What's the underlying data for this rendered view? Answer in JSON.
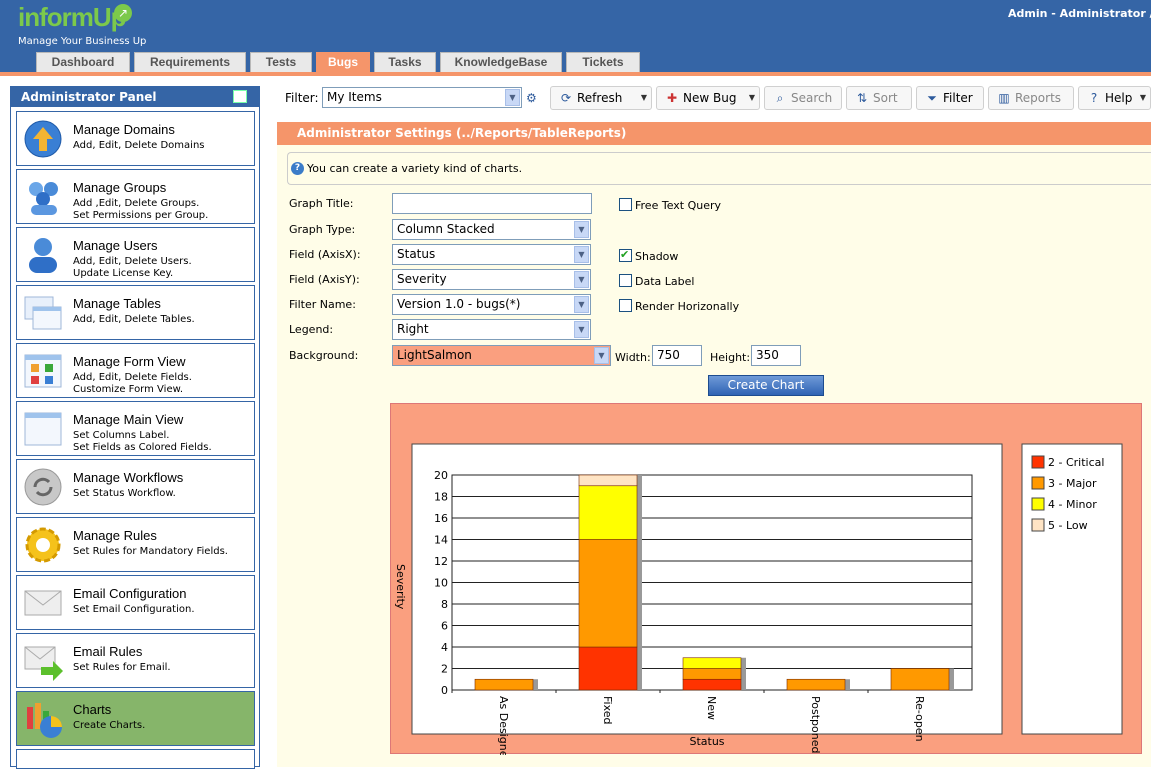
{
  "header": {
    "logo": "informUp",
    "tagline": "Manage Your Business Up",
    "user_text": "Admin -  Administrator  / S",
    "tabs": [
      {
        "label": "Dashboard"
      },
      {
        "label": "Requirements"
      },
      {
        "label": "Tests"
      },
      {
        "label": "Bugs",
        "active": true
      },
      {
        "label": "Tasks"
      },
      {
        "label": "KnowledgeBase"
      },
      {
        "label": "Tickets"
      }
    ]
  },
  "panel": {
    "title": "Administrator Panel",
    "items": [
      {
        "title": "Manage Domains",
        "desc": "Add, Edit, Delete Domains",
        "icon": "globe-icon"
      },
      {
        "title": "Manage Groups",
        "desc": "Add ,Edit, Delete Groups.\nSet Permissions per Group.",
        "icon": "group-icon"
      },
      {
        "title": "Manage Users",
        "desc": "Add, Edit, Delete Users.\nUpdate License Key.",
        "icon": "user-icon"
      },
      {
        "title": "Manage Tables",
        "desc": "Add, Edit, Delete Tables.",
        "icon": "tables-icon"
      },
      {
        "title": "Manage Form View",
        "desc": "Add, Edit, Delete Fields.\nCustomize Form View.",
        "icon": "form-view-icon"
      },
      {
        "title": "Manage Main View",
        "desc": "Set Columns Label.\nSet Fields as Colored Fields.",
        "icon": "main-view-icon"
      },
      {
        "title": "Manage Workflows",
        "desc": "Set Status Workflow.",
        "icon": "workflow-icon"
      },
      {
        "title": "Manage Rules",
        "desc": "Set Rules for Mandatory Fields.",
        "icon": "gear-icon"
      },
      {
        "title": "Email Configuration",
        "desc": "Set Email Configuration.",
        "icon": "envelope-icon"
      },
      {
        "title": "Email Rules",
        "desc": "Set Rules for Email.",
        "icon": "email-rules-icon"
      },
      {
        "title": "Charts",
        "desc": "Create Charts.",
        "icon": "chart-icon",
        "active": true
      }
    ]
  },
  "toolbar": {
    "filter_label": "Filter:",
    "filter_value": "My Items",
    "refresh": "Refresh",
    "new_bug": "New Bug",
    "search": "Search",
    "sort": "Sort",
    "filter": "Filter",
    "reports": "Reports",
    "help": "Help"
  },
  "settings": {
    "bar_title": "Administrator Settings  (../Reports/TableReports)",
    "info": "You can create a variety kind of charts.",
    "graph_title_label": "Graph Title:",
    "graph_title_value": "",
    "graph_type_label": "Graph Type:",
    "graph_type_value": "Column Stacked",
    "axis_x_label": "Field (AxisX):",
    "axis_x_value": "Status",
    "axis_y_label": "Field (AxisY):",
    "axis_y_value": "Severity",
    "filter_name_label": "Filter Name:",
    "filter_name_value": "Version 1.0 - bugs(*)",
    "legend_label": "Legend:",
    "legend_value": "Right",
    "background_label": "Background:",
    "background_value": "LightSalmon",
    "width_label": "Width:",
    "width_value": "750",
    "height_label": "Height:",
    "height_value": "350",
    "free_text_query": "Free Text Query",
    "shadow": "Shadow",
    "data_label": "Data Label",
    "render_horizontally": "Render Horizonally",
    "free_text_checked": false,
    "shadow_checked": true,
    "data_label_checked": false,
    "render_horizontally_checked": false,
    "create_button": "Create Chart"
  },
  "chart_data": {
    "type": "bar",
    "stacked": true,
    "categories": [
      "As Designed",
      "Fixed",
      "New",
      "Postponed",
      "Re-open"
    ],
    "series": [
      {
        "name": "2 - Critical",
        "color": "#ff3300",
        "values": [
          0,
          4,
          1,
          0,
          0
        ]
      },
      {
        "name": "3 - Major",
        "color": "#ff9900",
        "values": [
          1,
          10,
          1,
          1,
          2
        ]
      },
      {
        "name": "4 - Minor",
        "color": "#ffff00",
        "values": [
          0,
          5,
          1,
          0,
          0
        ]
      },
      {
        "name": "5 - Low",
        "color": "#ffe4c4",
        "values": [
          0,
          1,
          0,
          0,
          0
        ]
      }
    ],
    "title": "",
    "xlabel": "Status",
    "ylabel": "Severity",
    "ylim": [
      0,
      20
    ],
    "yticks": [
      0,
      2,
      4,
      6,
      8,
      10,
      12,
      14,
      16,
      18,
      20
    ],
    "legend": "right",
    "grid": true,
    "background": "LightSalmon"
  }
}
